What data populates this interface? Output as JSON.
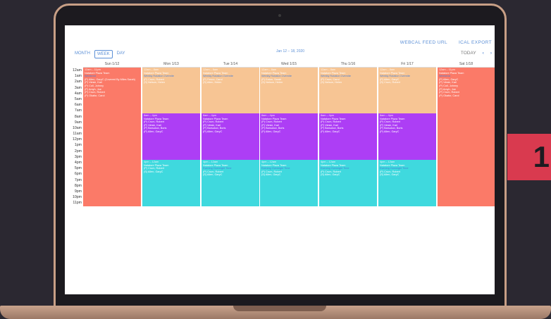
{
  "toplinks": {
    "webcal": "WEBCAL FEED URL",
    "ical": "ICAL EXPORT"
  },
  "views": {
    "month": "MONTH",
    "week": "WEEK",
    "day": "DAY"
  },
  "range": "Jan 12 – 18, 2020",
  "nav": {
    "today": "TODAY",
    "prev": "‹",
    "next": "›"
  },
  "badge": "1",
  "times": [
    "12am",
    "1am",
    "2am",
    "3am",
    "4am",
    "5am",
    "6am",
    "7am",
    "8am",
    "9am",
    "10am",
    "11am",
    "12pm",
    "1pm",
    "2pm",
    "3pm",
    "4pm",
    "5pm",
    "6pm",
    "7pm",
    "8pm",
    "9pm",
    "10pm",
    "11pm"
  ],
  "days": [
    "Sun 1/12",
    "Mon 1/13",
    "Tue 1/14",
    "Wed 1/15",
    "Thu 1/16",
    "Fri 1/17",
    "Sat 1/18"
  ],
  "colors": {
    "coral": "#fb7a68",
    "peach": "#f7c594",
    "purple": "#ad3ef5",
    "teal": "#3fd9de"
  },
  "events": {
    "sun": {
      "time": "12am – 11pm",
      "title": "Natatore Plaza Team",
      "sub": "Weekend",
      "lines": [
        "(P) Allen, GaryC (Covered By Miles Sarah)",
        "(P) Vieski, Karl",
        "(P) Coll, Johnny",
        "(P) Amyh, Joe",
        "(P) Crum, Robert",
        "(P) Okafor, Carol"
      ]
    },
    "mon_a": {
      "time": "12am – 8am",
      "title": "Natatore Plaza Team",
      "sub": "Weekly Rotation Overnite",
      "lines": [
        "(P) Crum, Robert",
        "(S) Nelson, Helen"
      ]
    },
    "mon_b": {
      "time": "8am – 4pm",
      "title": "Natatore Plaza Team",
      "sub": "",
      "lines": [
        "(P) Crum, Robert",
        "(P) Vieski, Karl",
        "(P) Barsukov, Boris",
        "(P) Allen, GaryC"
      ]
    },
    "mon_c": {
      "time": "4pm – 12am",
      "title": "Natatore Plaza Team",
      "sub": "",
      "lines": [
        "(P) Crum, Robert",
        "(S) Allen, GaryC"
      ]
    },
    "tue_a": {
      "time": "12am – 8am",
      "title": "Natatore Plaza Team",
      "sub": "Weekly Rotation Overnite",
      "lines": [
        "(P) Fesco, Carol",
        "(S) Allen, Helen"
      ]
    },
    "tue_b": {
      "time": "8am – 4pm",
      "title": "Natatore Plaza Team",
      "sub": "",
      "lines": [
        "(P) Crum, Robert",
        "(P) Vieski, Karl",
        "(P) Barsukov, Boris",
        "(P) Allen, GaryC"
      ]
    },
    "tue_c": {
      "time": "4pm – 12am",
      "title": "Natatore Plaza Team",
      "sub": "Evening Overnight Time",
      "lines": [
        "(P) Crum, Robert",
        "(S) Allen, GaryC"
      ]
    },
    "wed_a": {
      "time": "12am – 8am",
      "title": "Natatore Plaza Team",
      "sub": "Weekly Rotation Overnite",
      "lines": [
        "(P) Eaton, Sarah",
        "(S) Nelson, Helen"
      ]
    },
    "wed_b": {
      "time": "8am – 4pm",
      "title": "Natatore Plaza Team",
      "sub": "",
      "lines": [
        "(P) Crum, Robert",
        "(P) Vieski, Karl",
        "(P) Barsukov, Boris",
        "(P) Allen, GaryC"
      ]
    },
    "wed_c": {
      "time": "4pm – 12am",
      "title": "Natatore Plaza Team",
      "sub": "Evening Overnight Time",
      "lines": [
        "(P) Crum, Robert",
        "(S) Allen, GaryC"
      ]
    },
    "thu_a": {
      "time": "12am – 8am",
      "title": "Natatore Plaza Team",
      "sub": "Weekly Rotation Overnite",
      "lines": [
        "(P) Crum, Carol",
        "(S) Nelson, Helen"
      ]
    },
    "thu_b": {
      "time": "8am – 4pm",
      "title": "Natatore Plaza Team",
      "sub": "",
      "lines": [
        "(P) Crum, Robert",
        "(P) Vieski, Karl",
        "(P) Barsukov, Boris",
        "(P) Allen, GaryC"
      ]
    },
    "thu_c": {
      "time": "4pm – 12am",
      "title": "Natatore Plaza Team",
      "sub": "Evening Overnight Time",
      "lines": [
        "(P) Crum, Robert",
        "(S) Allen, GaryC"
      ]
    },
    "fri_a": {
      "time": "12am – 8am",
      "title": "Natatore Plaza Team",
      "sub": "Weekly Rotation Overnite",
      "lines": [
        "(P) Allen, GaryC",
        "(S) Crum, Robert"
      ]
    },
    "fri_b": {
      "time": "8am – 4pm",
      "title": "Natatore Plaza Team",
      "sub": "",
      "lines": [
        "(P) Crum, Robert",
        "(P) Vieski, Karl",
        "(P) Barsukov, Boris",
        "(P) Allen, GaryC"
      ]
    },
    "fri_c": {
      "time": "4pm – 12am",
      "title": "Natatore Plaza Team",
      "sub": "Evening Overnight Time",
      "lines": [
        "(P) Crum, Robert",
        "(S) Allen, GaryC"
      ]
    },
    "sat": {
      "time": "12am – 11pm",
      "title": "Natatore Plaza Team",
      "sub": "Weekend",
      "lines": [
        "(P) Allen, GaryC",
        "(P) Vieski, Karl",
        "(P) Coll, Johnny",
        "(P) Amyh, Joe",
        "(P) Crum, Robert",
        "(P) Okafor, Carol"
      ]
    }
  }
}
